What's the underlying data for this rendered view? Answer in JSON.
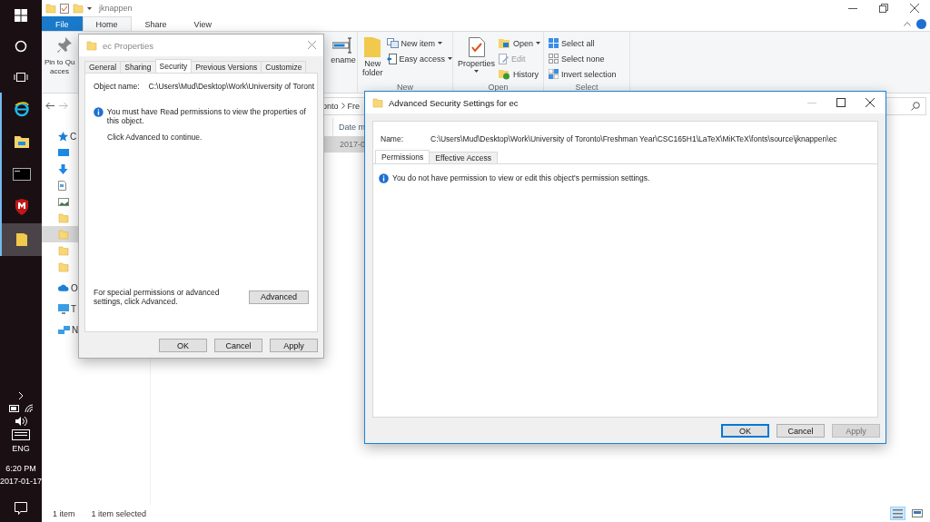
{
  "taskbar": {
    "apps": [
      {
        "running": true,
        "selected": false
      },
      {
        "running": true,
        "selected": false
      },
      {
        "running": true,
        "selected": false
      },
      {
        "running": true,
        "selected": false
      },
      {
        "running": true,
        "selected": true
      }
    ],
    "tray": {
      "language": "ENG",
      "time": "6:20 PM",
      "date": "2017-01-17"
    }
  },
  "explorer": {
    "title": "jknappen",
    "tabs": [
      {
        "label": "File",
        "kind": "file",
        "selected": false
      },
      {
        "label": "Home",
        "kind": "tab",
        "selected": true
      },
      {
        "label": "Share",
        "kind": "tab",
        "selected": false
      },
      {
        "label": "View",
        "kind": "tab",
        "selected": false
      }
    ],
    "ribbon": {
      "pin": {
        "line1": "Pin to Qu",
        "line2": "acces"
      },
      "rename": "ename",
      "groups": [
        {
          "label": "New",
          "large": {
            "label": "New folder",
            "kind": "folder",
            "dropdown": false
          },
          "small": [
            {
              "label": "New item",
              "kind": "new-item",
              "dropdown": true,
              "disabled": false
            },
            {
              "label": "Easy access",
              "kind": "easy-access",
              "dropdown": true,
              "disabled": false
            }
          ]
        },
        {
          "label": "Open",
          "large": {
            "label": "Properties",
            "kind": "properties",
            "dropdown": true
          },
          "small": [
            {
              "label": "Open",
              "kind": "open",
              "dropdown": true,
              "disabled": false
            },
            {
              "label": "Edit",
              "kind": "edit",
              "dropdown": false,
              "disabled": true
            },
            {
              "label": "History",
              "kind": "history",
              "dropdown": false,
              "disabled": false
            }
          ]
        },
        {
          "label": "Select",
          "small": [
            {
              "label": "Select all",
              "kind": "select-all",
              "dropdown": false,
              "disabled": false
            },
            {
              "label": "Select none",
              "kind": "select-none",
              "dropdown": false,
              "disabled": false
            },
            {
              "label": "Invert selection",
              "kind": "invert",
              "dropdown": false,
              "disabled": false
            }
          ]
        }
      ]
    },
    "address": {
      "crumbs": [
        "onto",
        "Fre"
      ]
    },
    "nav": [
      {
        "kind": "star",
        "text": "C",
        "selected": false
      },
      {
        "kind": "desktop",
        "selected": false
      },
      {
        "kind": "download",
        "selected": false
      },
      {
        "kind": "document",
        "selected": false
      },
      {
        "kind": "image",
        "selected": false
      },
      {
        "kind": "folder",
        "selected": false
      },
      {
        "kind": "folder",
        "selected": true
      },
      {
        "kind": "folder",
        "selected": false
      },
      {
        "kind": "folder",
        "selected": false
      },
      {
        "kind": "cloud",
        "text": "O",
        "selected": false
      },
      {
        "kind": "pc",
        "text": "T",
        "selected": false
      },
      {
        "kind": "network",
        "text": "N",
        "selected": false
      }
    ],
    "columns": [
      "Date m"
    ],
    "rows": [
      {
        "cells": [
          "2017-0"
        ],
        "selected": true
      }
    ],
    "status": [
      "1 item",
      "1 item selected"
    ],
    "views": [
      {
        "kind": "details",
        "selected": true
      },
      {
        "kind": "tiles",
        "selected": false
      }
    ]
  },
  "properties_dialog": {
    "title": "ec Properties",
    "tabs": [
      {
        "label": "General",
        "selected": false
      },
      {
        "label": "Sharing",
        "selected": false
      },
      {
        "label": "Security",
        "selected": true
      },
      {
        "label": "Previous Versions",
        "selected": false
      },
      {
        "label": "Customize",
        "selected": false
      }
    ],
    "object_label": "Object name:",
    "object_value": "C:\\Users\\Mud\\Desktop\\Work\\University of Toront",
    "message": "You must have Read permissions to view the properties of this object.",
    "hint": "Click Advanced to continue.",
    "advanced_text": "For special permissions or advanced settings, click Advanced.",
    "advanced_button": "Advanced",
    "buttons": [
      {
        "label": "OK",
        "default": false,
        "disabled": false
      },
      {
        "label": "Cancel",
        "default": false,
        "disabled": false
      },
      {
        "label": "Apply",
        "default": false,
        "disabled": false
      }
    ]
  },
  "advanced_dialog": {
    "title": "Advanced Security Settings for ec",
    "minimize_disabled": true,
    "name_label": "Name:",
    "name_value": "C:\\Users\\Mud\\Desktop\\Work\\University of Toronto\\Freshman Year\\CSC165H1\\LaTeX\\MiKTeX\\fonts\\source\\jknappen\\ec",
    "tabs": [
      {
        "label": "Permissions",
        "selected": true
      },
      {
        "label": "Effective Access",
        "selected": false
      }
    ],
    "message": "You do not have permission to view or edit this object's permission settings.",
    "buttons": [
      {
        "label": "OK",
        "default": true,
        "disabled": false
      },
      {
        "label": "Cancel",
        "default": false,
        "disabled": false
      },
      {
        "label": "Apply",
        "default": false,
        "disabled": true
      }
    ]
  }
}
